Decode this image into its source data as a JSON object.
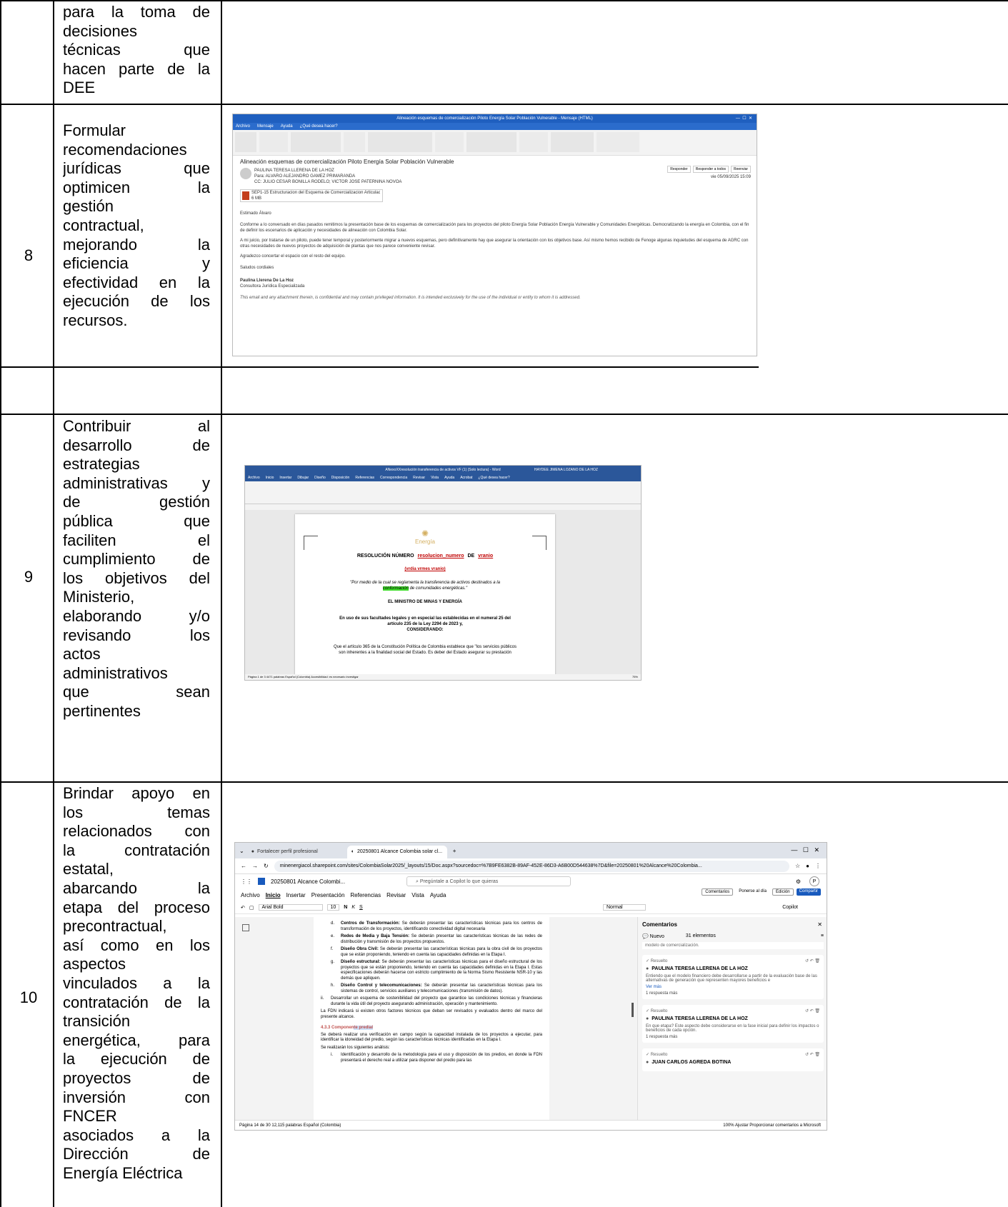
{
  "rows": [
    {
      "number": "",
      "description_lines": [
        "para la toma de",
        "decisiones",
        "técnicas que",
        "hacen parte de la",
        "DEE"
      ]
    },
    {
      "number": "8",
      "description_lines": [
        "Formular",
        "recomendaciones",
        "jurídicas que",
        "optimicen la",
        "gestión",
        "contractual,",
        "mejorando la",
        "eficiencia y",
        "efectividad en la",
        "ejecución de los",
        "recursos."
      ]
    },
    {
      "number": "9",
      "description_lines": [
        "Contribuir al",
        "desarrollo de",
        "estrategias",
        "administrativas y",
        "de gestión",
        "pública que",
        "faciliten el",
        "cumplimiento de",
        "los objetivos del",
        "Ministerio,",
        "elaborando y/o",
        "revisando los",
        "actos",
        "administrativos",
        "que sean",
        "pertinentes"
      ]
    },
    {
      "number": "10",
      "description_lines": [
        "Brindar apoyo en",
        "los temas",
        "relacionados con",
        "la contratación",
        "estatal,",
        "abarcando la",
        "etapa del proceso",
        "precontractual,",
        "así como en los",
        "aspectos",
        "vinculados a la",
        "contratación de la",
        "transición",
        "energética, para",
        "la ejecución de",
        "proyectos de",
        "inversión con",
        "FNCER",
        "asociados a la",
        "Dirección de",
        "Energía Eléctrica"
      ]
    }
  ],
  "outlook": {
    "window_title": "Alineación esquemas de comercialización Piloto Energía Solar Población Vulnerable - Mensaje (HTML)",
    "tabs": [
      "Archivo",
      "Mensaje",
      "Ayuda",
      "¿Qué desea hacer?"
    ],
    "subject": "Alineación esquemas de comercialización Piloto Energía Solar Población Vulnerable",
    "sender": "PAULINA TERESA LLERENA DE LA HOZ",
    "to": "Para: ALVARO ALEJANDRO GAMEZ PRIMARANDA",
    "cc": "CC: JULIO CESAR BONILLA RODELO; VICTOR JOSE PATERNINA NOVOA",
    "attachment": "SEP1-15 Estructuracion del Esquema de Comercializacion Articulación Energia solar.pptx",
    "attachment_size": "6 MB",
    "actions": [
      "Responder",
      "Responder a todos",
      "Reenviar"
    ],
    "date": "vie 05/09/2025 15:09",
    "greeting": "Estimado Álvaro",
    "body1": "Conforme a lo conversado en días pasados remitimos la presentación base de los esquemas de comercialización para los proyectos del piloto Energía Solar Población Energía Vulnerable y Comunidades Energéticas. Democratizando la energía en Colombia, con el fin de definir los escenarios de aplicación y necesidades de alineación con Colombia Solar.",
    "body2": "A mi juicio, por tratarse de un piloto, puede tener temporal y posteriormente migrar a nuevos esquemas, pero definitivamente hay que asegurar la orientación con los objetivos base. Así mismo hemos recibido de Fenoge algunas inquietudes del esquema de AGRC con otras necesidades de nuevos proyectos de adquisición de plantas que nos parece conveniente revisar.",
    "body3": "Agradezco concertar el espacio con el resto del equipo.",
    "closing": "Saludos cordiales",
    "signature": "Paulina Llerena De La Hoz",
    "signature_role": "Consultora Jurídica Especializada",
    "disclaimer": "This email and any attachment therein, is confidential and may contain privileged information. It is intended exclusively for the use of the individual or entity to whom it is addressed."
  },
  "word": {
    "window_title": "ANexoXXresolución transferencia de activos VF (1) (Solo lectura) - Word",
    "user": "HAYDEE JIMENA LOZANO DE LA HOZ",
    "tabs": [
      "Archivo",
      "Inicio",
      "Insertar",
      "Dibujar",
      "Diseño",
      "Disposición",
      "Referencias",
      "Correspondencia",
      "Revisar",
      "Vista",
      "Ayuda",
      "Acrobat",
      "¿Qué desea hacer?"
    ],
    "logo_text": "Energía",
    "heading": "RESOLUCIÓN NÚMERO",
    "heading_field1": "resolucion_numero",
    "heading_de": "DE",
    "heading_field2": "vranio",
    "date_fields": "(vrdia vrmes vranio)",
    "quote_line1": "\"Por medio de la cual se reglamenta la transferencia de activos destinados a la",
    "quote_highlight": "conformación",
    "quote_line2": " de comunidades energéticas.\"",
    "minister": "EL MINISTRO DE MINAS Y ENERGÍA",
    "uses1": "En uso de sus facultades legales y en especial las establecidas en el numeral 25 del",
    "uses2": "artículo 235 de la Ley 2294 de 2023 y,",
    "considering": "CONSIDERANDO:",
    "para1": "Que el artículo 365 de la Constitución Política de Colombia establece que \"los servicios públicos",
    "para2": "son inherentes a la finalidad social del Estado. Es deber del Estado asegurar su prestación",
    "status": "Página 1 de 3   4471 palabras   Español (Colombia)   Accesibilidad: es necesario investigar",
    "zoom": "75%"
  },
  "browser": {
    "tab1": "Fortalecer perfil profesional",
    "tab2": "20250801 Alcance Colombia solar cl...",
    "url": "minenergiacol.sharepoint.com/sites/ColombiaSolar2025/_layouts/15/Doc.aspx?sourcedoc=%7B9FE6382B-89AF-452E-86D3-A6B00D544638%7D&file=20250801%20Alcance%20Colombia...",
    "doc_name": "20250801 Alcance Colombi...",
    "search_placeholder": "Pregúntale a Copilot lo que quieras",
    "avatar_letter": "P",
    "menu": [
      "Archivo",
      "Inicio",
      "Insertar",
      "Presentación",
      "Referencias",
      "Revisar",
      "Vista",
      "Ayuda"
    ],
    "comments_btn": "Comentarios",
    "catch_up": "Ponerse al día",
    "editing": "Edición",
    "share": "Compartir",
    "font": "Arial Bold",
    "font_size": "10",
    "style": "Normal",
    "copilot": "Copilot",
    "doc_items": [
      {
        "label": "d.",
        "title": "Centros de Transformación:",
        "text": "Se deberán presentar las características técnicas para los centros de transformación de los proyectos, identificando conectividad digital necesaria"
      },
      {
        "label": "e.",
        "title": "Redes de Media y Baja Tensión:",
        "text": "Se deberán presentar las características técnicas de las redes de distribución y transmisión de los proyectos propuestos."
      },
      {
        "label": "f.",
        "title": "Diseño Obra Civil:",
        "text": "Se deberán presentar las características técnicas para la obra civil de los proyectos que se están proponiendo, teniendo en cuenta las capacidades definidas en la Etapa I."
      },
      {
        "label": "g.",
        "title": "Diseño estructural:",
        "text": "Se deberán presentar las características técnicas para el diseño estructural de los proyectos que se están proponiendo, teniendo en cuenta las capacidades definidas en la Etapa I. Estas especificaciones deberán hacerse con estricto cumplimiento de la Norma Sismo Resistente NSR-10 y las demás que apliquen."
      },
      {
        "label": "h.",
        "title": "Diseño Control y telecomunicaciones:",
        "text": "Se deberán presentar las características técnicas para los sistemas de control, servicios auxiliares y telecomunicaciones (transmisión de datos)."
      }
    ],
    "item_ii": "Desarrollar un esquema de sostenibilidad del proyecto que garantice las condiciones técnicas y financieras durante la vida útil del proyecto asegurando administración, operación y mantenimiento.",
    "fdn": "La FDN indicará si existen otros factores técnicos que deban ser revisados y evaluados dentro del marco del presente alcance.",
    "section_num": "4.3.3",
    "section_title_a": "Componen",
    "section_title_b": "te predial",
    "section_text": "Se deberá realizar una verificación en campo según la capacidad instalada de los proyectos a ejecutar, para identificar la idoneidad del predio, según las características técnicas identificadas en la Etapa I.",
    "analysis": "Se realizarán los siguientes análisis:",
    "item_i": "Identificación y desarrollo de la metodología para el uso y disposición de los predios, en donde la FDN presentará el derecho real a utilizar para disponer del predio para las",
    "status": "Página 14 de 30   12,115 palabras   Español (Colombia)",
    "zoom_text": "100%   Ajustar   Proporcionar comentarios a Microsoft",
    "panel_title": "Comentarios",
    "new_btn": "Nuevo",
    "count": "31 elementos",
    "snippet": "modelo de comercialización.",
    "comments": [
      {
        "status": "Resuelto",
        "author": "PAULINA TERESA LLERENA DE LA HOZ",
        "text": "Entiendo que el modelo financiero debe desarrollarse a partir de la evaluación base de las alternativas de generación que representen mayores beneficios e",
        "more": "Ver más",
        "replies": "1 respuesta más"
      },
      {
        "status": "Resuelto",
        "author": "PAULINA TERESA LLERENA DE LA HOZ",
        "text": "En que etapa? Este aspecto debe considerarse en la fase inicial para definir los impactos o beneficios de cada opción.",
        "more": "",
        "replies": "1 respuesta más"
      },
      {
        "status": "Resuelto",
        "author": "JUAN CARLOS AGREDA BOTINA",
        "text": "",
        "more": "",
        "replies": ""
      }
    ]
  }
}
